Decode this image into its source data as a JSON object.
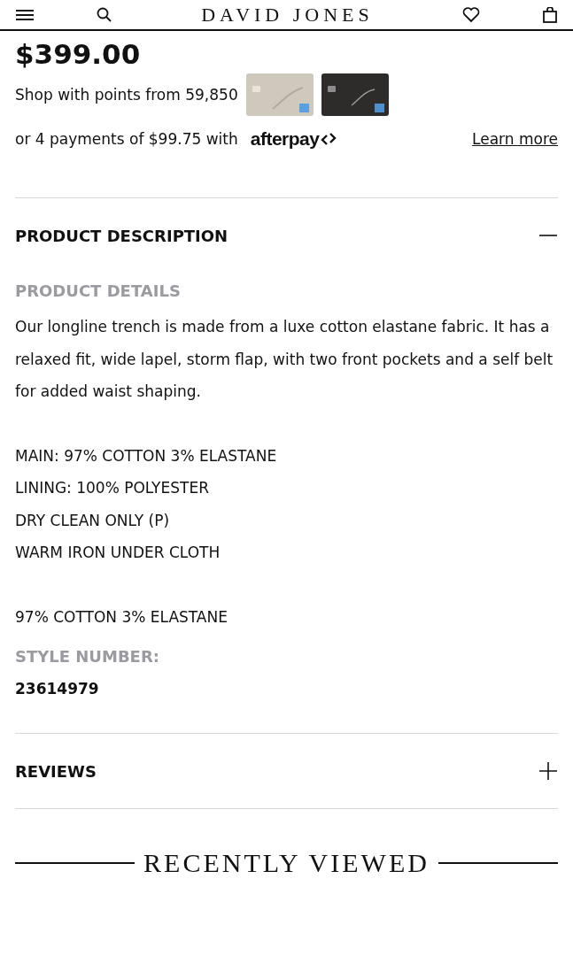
{
  "header": {
    "logo": "DAVID JONES"
  },
  "price": "$399.00",
  "points": {
    "text": "Shop with points from 59,850"
  },
  "afterpay": {
    "text": "or 4 payments of $99.75 with",
    "brand": "afterpay",
    "link": "Learn more"
  },
  "sections": [
    {
      "title": "PRODUCT DESCRIPTION",
      "expanded": true,
      "details_heading": "PRODUCT DETAILS",
      "paragraph": "Our longline trench is made from a luxe cotton elastane fabric. It has a relaxed fit, wide lapel, storm flap, with two front pockets and a self belt for added waist shaping.",
      "care_lines": [
        "MAIN: 97% COTTON 3% ELASTANE",
        "LINING: 100% POLYESTER",
        "DRY CLEAN ONLY (P)",
        "WARM IRON UNDER CLOTH"
      ],
      "composition": "97% COTTON 3% ELASTANE",
      "style_heading": "STYLE NUMBER:",
      "style_number": "23614979"
    },
    {
      "title": "REVIEWS",
      "expanded": false
    }
  ],
  "recently_viewed": "RECENTLY VIEWED"
}
